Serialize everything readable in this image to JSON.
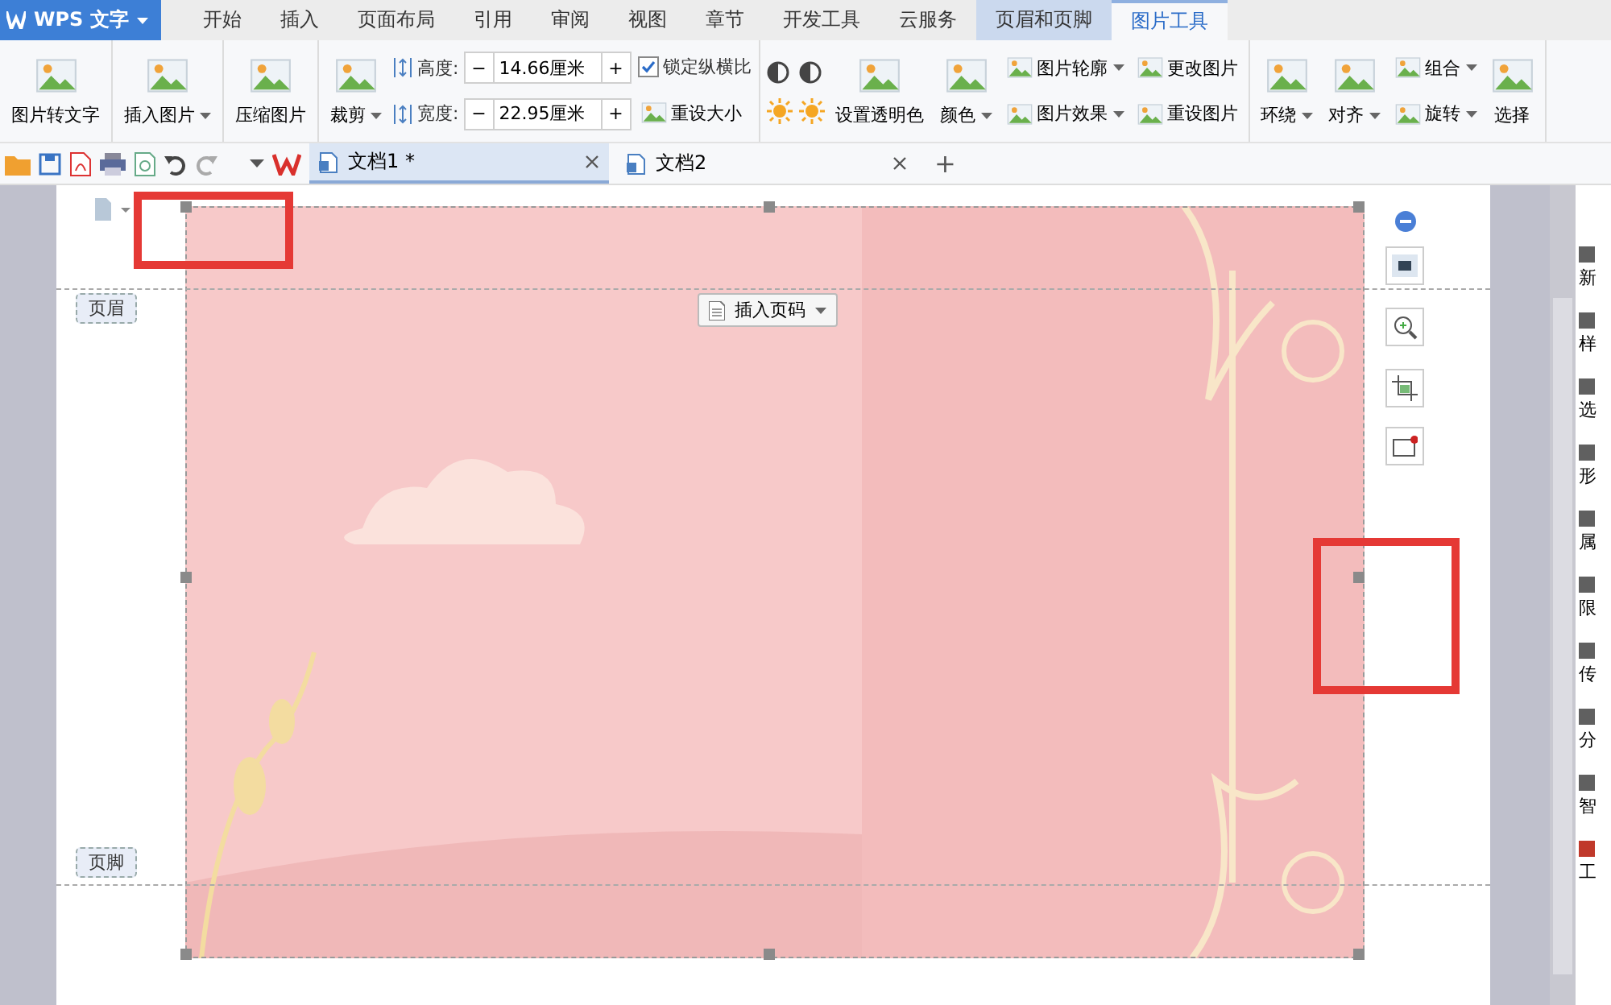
{
  "app_button": {
    "label": "WPS 文字"
  },
  "tabs": [
    {
      "label": "开始",
      "selected": false,
      "contextual": false
    },
    {
      "label": "插入",
      "selected": false,
      "contextual": false
    },
    {
      "label": "页面布局",
      "selected": false,
      "contextual": false
    },
    {
      "label": "引用",
      "selected": false,
      "contextual": false
    },
    {
      "label": "审阅",
      "selected": false,
      "contextual": false
    },
    {
      "label": "视图",
      "selected": false,
      "contextual": false
    },
    {
      "label": "章节",
      "selected": false,
      "contextual": false
    },
    {
      "label": "开发工具",
      "selected": false,
      "contextual": false
    },
    {
      "label": "云服务",
      "selected": false,
      "contextual": false
    },
    {
      "label": "页眉和页脚",
      "selected": false,
      "contextual": true
    },
    {
      "label": "图片工具",
      "selected": true,
      "contextual": true
    }
  ],
  "ribbon": {
    "groups": [
      {
        "columns": [
          {
            "kind": "large",
            "label": "图片转文字",
            "dropdown": false
          }
        ]
      },
      {
        "columns": [
          {
            "kind": "large",
            "label": "插入图片",
            "dropdown": true
          }
        ]
      },
      {
        "columns": [
          {
            "kind": "large",
            "label": "压缩图片",
            "dropdown": false
          }
        ]
      },
      {
        "columns": [
          {
            "kind": "large",
            "label": "裁剪",
            "dropdown": true
          },
          {
            "kind": "stack",
            "items": [
              {
                "kind": "spin",
                "label": "高度:",
                "value": "14.66厘米",
                "minus": "−",
                "plus": "+"
              },
              {
                "kind": "spin",
                "label": "宽度:",
                "value": "22.95厘米",
                "minus": "−",
                "plus": "+"
              }
            ]
          },
          {
            "kind": "stack",
            "items": [
              {
                "kind": "check",
                "label": "锁定纵横比",
                "checked": true
              },
              {
                "kind": "button",
                "label": "重设大小",
                "dropdown": false
              }
            ]
          }
        ]
      },
      {
        "columns": [
          {
            "kind": "icons"
          },
          {
            "kind": "large",
            "label": "设置透明色",
            "dropdown": false
          },
          {
            "kind": "large",
            "label": "颜色",
            "dropdown": true
          },
          {
            "kind": "stack",
            "items": [
              {
                "kind": "button",
                "label": "图片轮廓",
                "dropdown": true
              },
              {
                "kind": "button",
                "label": "图片效果",
                "dropdown": true
              }
            ]
          },
          {
            "kind": "stack",
            "items": [
              {
                "kind": "button",
                "label": "更改图片",
                "dropdown": false
              },
              {
                "kind": "button",
                "label": "重设图片",
                "dropdown": false
              }
            ]
          }
        ]
      },
      {
        "columns": [
          {
            "kind": "large",
            "label": "环绕",
            "dropdown": true
          },
          {
            "kind": "large",
            "label": "对齐",
            "dropdown": true
          },
          {
            "kind": "stack",
            "items": [
              {
                "kind": "button",
                "label": "组合",
                "dropdown": true
              },
              {
                "kind": "button",
                "label": "旋转",
                "dropdown": true
              }
            ]
          },
          {
            "kind": "large",
            "label": "选择",
            "dropdown": false
          }
        ]
      }
    ]
  },
  "doc_tabs": [
    {
      "label": "文档1 *",
      "selected": true
    },
    {
      "label": "文档2",
      "selected": false
    }
  ],
  "new_tab": "+",
  "page": {
    "header_tag": "页眉",
    "footer_tag": "页脚",
    "page_number_button": "插入页码"
  },
  "side_panel": [
    {
      "label": "新",
      "color": "#606060"
    },
    {
      "label": "样",
      "color": "#606060"
    },
    {
      "label": "选",
      "color": "#606060"
    },
    {
      "label": "形",
      "color": "#606060"
    },
    {
      "label": "属",
      "color": "#606060"
    },
    {
      "label": "限",
      "color": "#606060"
    },
    {
      "label": "传",
      "color": "#606060"
    },
    {
      "label": "分",
      "color": "#606060"
    },
    {
      "label": "智",
      "color": "#606060"
    },
    {
      "label": "工",
      "color": "#c0392b"
    }
  ]
}
